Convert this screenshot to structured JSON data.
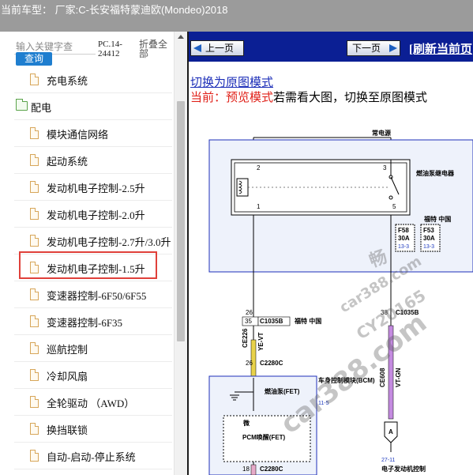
{
  "title_bar": {
    "text": "当前车型： 厂家:C-长安福特蒙迪欧(Mondeo)2018"
  },
  "sidebar": {
    "search_placeholder": "输入关键字查",
    "query_label": "查询",
    "version": "PC.14-24412",
    "collapse_label": "折叠全部",
    "items": [
      {
        "label": "充电系统",
        "type": "file"
      },
      {
        "label": "配电",
        "type": "folder"
      },
      {
        "label": "模块通信网络",
        "type": "file"
      },
      {
        "label": "起动系统",
        "type": "file"
      },
      {
        "label": "发动机电子控制-2.5升",
        "type": "file"
      },
      {
        "label": "发动机电子控制-2.0升",
        "type": "file"
      },
      {
        "label": "发动机电子控制-2.7升/3.0升",
        "type": "file"
      },
      {
        "label": "发动机电子控制-1.5升",
        "type": "file",
        "selected": true
      },
      {
        "label": "变速器控制-6F50/6F55",
        "type": "file"
      },
      {
        "label": "变速器控制-6F35",
        "type": "file"
      },
      {
        "label": "巡航控制",
        "type": "file"
      },
      {
        "label": "冷却风扇",
        "type": "file"
      },
      {
        "label": "全轮驱动 （AWD）",
        "type": "file"
      },
      {
        "label": "换挡联锁",
        "type": "file"
      },
      {
        "label": "自动-启动-停止系统",
        "type": "file"
      }
    ]
  },
  "toolbar": {
    "prev_label": "上一页",
    "next_label": "下一页",
    "refresh_label": "[刷新当前页"
  },
  "viewer": {
    "switch_link": "切换为原图模式",
    "current_prefix": "当前：",
    "preview_mode": "预览模式",
    "hint": "若需看大图，切换至原图模式"
  },
  "diagram": {
    "constant_power": "常电源",
    "relay_label": "燃油泵继电器",
    "pin_2": "2",
    "pin_1": "1",
    "pin_3": "3",
    "pin_5": "5",
    "fuse_box": "福特 中国",
    "fuse_f58": "F58",
    "fuse_f58_amp": "30A",
    "fuse_f58_ref": "13-3",
    "fuse_f53": "F53",
    "fuse_f53_amp": "30A",
    "fuse_f53_ref": "13-3",
    "conn_26": "26",
    "conn_35": "35",
    "conn_c1035b": "C1035B",
    "conn_fordchina": "福特 中国",
    "conn_38": "38",
    "conn_c1035b_2": "C1035B",
    "wire_ce226": "CE226",
    "wire_ye_vt": "YE-VT",
    "conn_26b": "26",
    "conn_c2280c": "C2280C",
    "wire_ce608": "CE608",
    "wire_vt_gn": "VT-GN",
    "fuel_pump_fet": "燃油泵(FET)",
    "bcm_label": "车身控制模块(BCM)",
    "bcm_ref": "11-5",
    "micro": "微",
    "pcm_wake": "PCM唤醒(FET)",
    "node_a": "A",
    "ref_27_11": "27-11",
    "ecu_label": "电子发动机控制",
    "conn_18": "18",
    "conn_c2280c_2": "C2280C",
    "wire_bottom": "OG",
    "watermarks": [
      "畅",
      "car388.com",
      "CY20165",
      "car388.com"
    ]
  },
  "colors": {
    "title_bar": "#9b9b9b",
    "nav_bar": "#0b1f94",
    "query_button": "#1f7ecf",
    "selection_box": "#e0403a",
    "wire_yellow": "#e8d24a",
    "wire_violet": "#c48be0",
    "module_border": "#1d2fb8"
  }
}
